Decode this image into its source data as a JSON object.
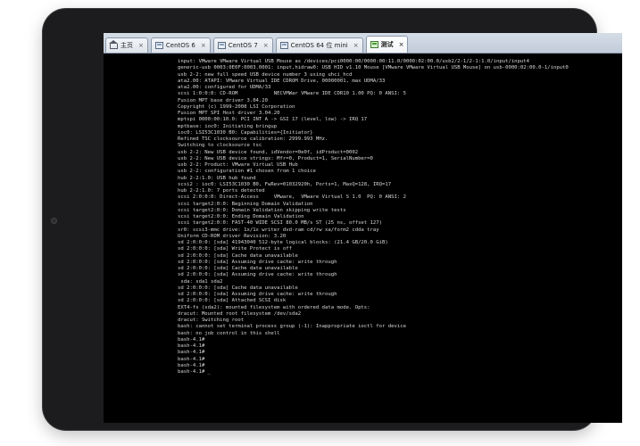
{
  "tabs": [
    {
      "label": "主页",
      "icon": "home-icon",
      "active": false
    },
    {
      "label": "CentOS 6",
      "icon": "vm-icon",
      "active": false
    },
    {
      "label": "CentOS 7",
      "icon": "vm-icon",
      "active": false
    },
    {
      "label": "CentOS 64 位 mini",
      "icon": "vm-icon",
      "active": false
    },
    {
      "label": "测试",
      "icon": "vm-icon",
      "active": true
    }
  ],
  "close_glyph": "×",
  "console_lines": [
    "input: VMware VMware Virtual USB Mouse as /devices/pci0000:00/0000:00:11.0/0000:02:00.0/usb2/2-1/2-1:1.0/input/input4",
    "generic-usb 0003:0E0F:0003.0001: input,hidraw0: USB HID v1.10 Mouse [VMware VMware Virtual USB Mouse] on usb-0000:02:00.0-1/input0",
    "usb 2-2: new full speed USB device number 3 using uhci_hcd",
    "ata2.00: ATAPI: VMware Virtual IDE CDROM Drive, 00000001, max UDMA/33",
    "ata2.00: configured for UDMA/33",
    "scsi 1:0:0:0: CD-ROM            NECVMWar VMware IDE CDR10 1.00 PQ: 0 ANSI: 5",
    "Fusion MPT base driver 3.04.20",
    "Copyright (c) 1999-2008 LSI Corporation",
    "Fusion MPT SPI Host driver 3.04.20",
    "mptspi 0000:00:10.0: PCI INT A -> GSI 17 (level, low) -> IRQ 17",
    "mptbase: ioc0: Initiating bringup",
    "ioc0: LSI53C1030 B0: Capabilities={Initiator}",
    "Refined TSC clocksource calibration: 2999.993 MHz.",
    "Switching to clocksource tsc",
    "usb 2-2: New USB device found, idVendor=0e0f, idProduct=0002",
    "usb 2-2: New USB device strings: Mfr=0, Product=1, SerialNumber=0",
    "usb 2-2: Product: VMware Virtual USB Hub",
    "usb 2-2: configuration #1 chosen from 1 choice",
    "hub 2-2:1.0: USB hub found",
    "scsi2 : ioc0: LSI53C1030 B0, FwRev=01032920h, Ports=1, MaxQ=128, IRQ=17",
    "hub 2-2:1.0: 7 ports detected",
    "scsi 2:0:0:0: Direct-Access     VMware,  VMware Virtual S 1.0  PQ: 0 ANSI: 2",
    "scsi target2:0:0: Beginning Domain Validation",
    "scsi target2:0:0: Domain Validation skipping write tests",
    "scsi target2:0:0: Ending Domain Validation",
    "scsi target2:0:0: FAST-40 WIDE SCSI 80.0 MB/s ST (25 ns, offset 127)",
    "sr0: scsi3-mmc drive: 1x/1x writer dvd-ram cd/rw xa/form2 cdda tray",
    "Uniform CD-ROM driver Revision: 3.20",
    "sd 2:0:0:0: [sda] 41943040 512-byte logical blocks: (21.4 GB/20.0 GiB)",
    "sd 2:0:0:0: [sda] Write Protect is off",
    "sd 2:0:0:0: [sda] Cache data unavailable",
    "sd 2:0:0:0: [sda] Assuming drive cache: write through",
    "sd 2:0:0:0: [sda] Cache data unavailable",
    "sd 2:0:0:0: [sda] Assuming drive cache: write through",
    " sda: sda1 sda2",
    "sd 2:0:0:0: [sda] Cache data unavailable",
    "sd 2:0:0:0: [sda] Assuming drive cache: write through",
    "sd 2:0:0:0: [sda] Attached SCSI disk",
    "EXT4-fs (sda2): mounted filesystem with ordered data mode. Opts:",
    "dracut: Mounted root filesystem /dev/sda2",
    "dracut: Switching root",
    "bash: cannot set terminal process group (-1): Inappropriate ioctl for device",
    "bash: no job control in this shell",
    "bash-4.1#",
    "bash-4.1#",
    "bash-4.1#",
    "bash-4.1#",
    "bash-4.1#",
    "bash-4.1#"
  ]
}
